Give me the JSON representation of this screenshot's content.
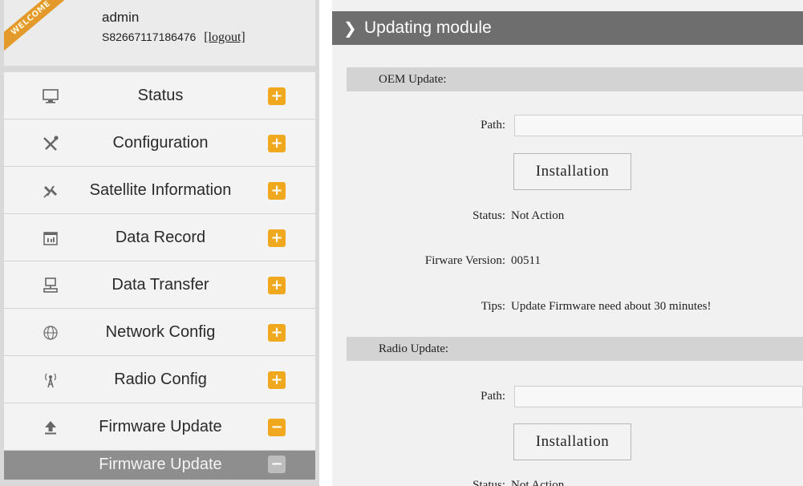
{
  "user": {
    "welcome_badge": "WELCOME",
    "username": "admin",
    "serial": "S82667117186476",
    "logout_label": "[logout]"
  },
  "sidebar": {
    "items": [
      {
        "label": "Status",
        "icon": "monitor-icon",
        "toggle": "+"
      },
      {
        "label": "Configuration",
        "icon": "tools-icon",
        "toggle": "+"
      },
      {
        "label": "Satellite Information",
        "icon": "satellite-icon",
        "toggle": "+"
      },
      {
        "label": "Data Record",
        "icon": "calendar-icon",
        "toggle": "+"
      },
      {
        "label": "Data Transfer",
        "icon": "network-computer-icon",
        "toggle": "+"
      },
      {
        "label": "Network Config",
        "icon": "globe-icon",
        "toggle": "+"
      },
      {
        "label": "Radio Config",
        "icon": "antenna-icon",
        "toggle": "+"
      },
      {
        "label": "Firmware Update",
        "icon": "upload-icon",
        "toggle": "−"
      }
    ],
    "submenu": [
      {
        "label": "Firmware Update",
        "toggle": "−"
      }
    ]
  },
  "main": {
    "header_title": "Updating module",
    "oem": {
      "section_title": "OEM Update:",
      "path_label": "Path:",
      "path_value": "",
      "install_label": "Installation",
      "status_label": "Status:",
      "status_value": "Not Action",
      "version_label": "Firware Version:",
      "version_value": "00511",
      "tips_label": "Tips:",
      "tips_value": "Update Firmware need about 30 minutes!"
    },
    "radio": {
      "section_title": "Radio Update:",
      "path_label": "Path:",
      "path_value": "",
      "install_label": "Installation",
      "status_label": "Status:",
      "status_value": "Not Action"
    }
  },
  "colors": {
    "toggle_orange": "#f0a91e",
    "header_gray": "#6e6e6e",
    "submenu_gray": "#8e8e8e",
    "ribbon_orange": "#e39a2b"
  }
}
